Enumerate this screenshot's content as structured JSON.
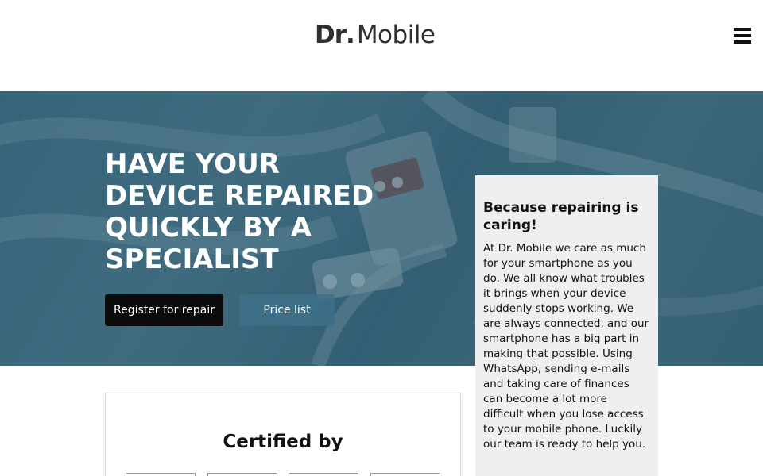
{
  "header": {
    "logo_dr": "Dr",
    "logo_dot": ".",
    "logo_mobile": "Mobile"
  },
  "hero": {
    "title": "HAVE YOUR DEVICE REPAIRED QUICKLY BY A SPECIALIST",
    "register_button": "Register for repair",
    "price_button": "Price list"
  },
  "card": {
    "title": "Because repairing is caring!",
    "text": "At Dr. Mobile we care as much for your smartphone as you do. We all know what troubles it brings when your device suddenly stops working. We are always connected, and our smartphone has a big part in making that possible. Using WhatsApp, sending e-mails and taking care of finances can become a lot more difficult when you lose access to your mobile phone. Luckily our team is ready to help you."
  },
  "certified": {
    "title": "Certified by"
  },
  "colors": {
    "hero_tint": "#3f6b80",
    "register_bg": "#0b0b0b",
    "price_bg": "#3e708a",
    "card_bg": "#efefef"
  }
}
